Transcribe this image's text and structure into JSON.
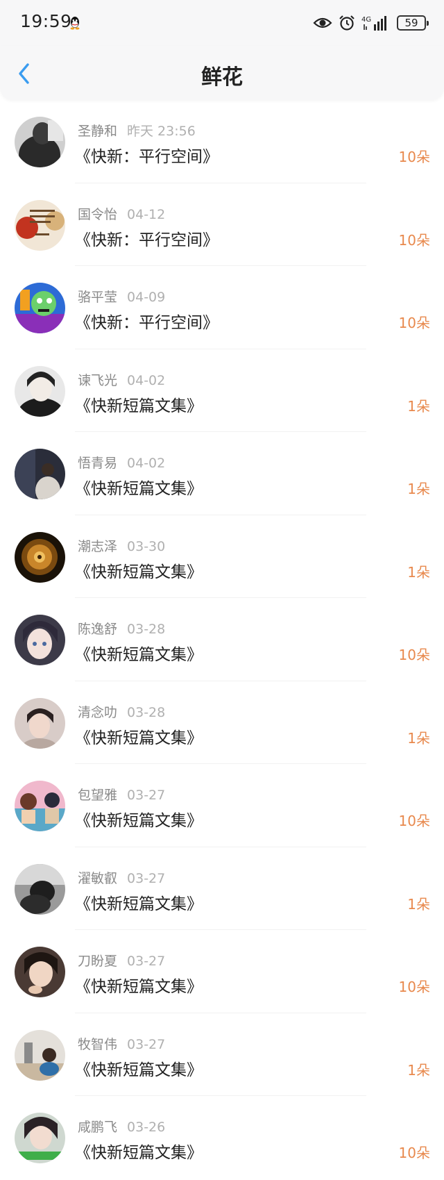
{
  "status_bar": {
    "time": "19:59",
    "battery": "59",
    "network": "4G",
    "icons": [
      "qq-icon",
      "eye-icon",
      "alarm-icon",
      "signal-icon",
      "battery-icon"
    ]
  },
  "header": {
    "title": "鲜花",
    "back_icon": "chevron-left-icon"
  },
  "colors": {
    "accent_blue": "#3a9cf0",
    "flower_orange": "#e8894d",
    "name_gray": "#8a8a8a",
    "date_gray": "#b0b0b0"
  },
  "gifts": [
    {
      "name": "圣静和",
      "date": "昨天 23:56",
      "book": "《快新：平行空间》",
      "flowers": "10朵"
    },
    {
      "name": "国令怡",
      "date": "04-12",
      "book": "《快新：平行空间》",
      "flowers": "10朵"
    },
    {
      "name": "骆平莹",
      "date": "04-09",
      "book": "《快新：平行空间》",
      "flowers": "10朵"
    },
    {
      "name": "谏飞光",
      "date": "04-02",
      "book": "《快新短篇文集》",
      "flowers": "1朵"
    },
    {
      "name": "悟青易",
      "date": "04-02",
      "book": "《快新短篇文集》",
      "flowers": "1朵"
    },
    {
      "name": "潮志泽",
      "date": "03-30",
      "book": "《快新短篇文集》",
      "flowers": "1朵"
    },
    {
      "name": "陈逸舒",
      "date": "03-28",
      "book": "《快新短篇文集》",
      "flowers": "10朵"
    },
    {
      "name": "清念叻",
      "date": "03-28",
      "book": "《快新短篇文集》",
      "flowers": "1朵"
    },
    {
      "name": "包望雅",
      "date": "03-27",
      "book": "《快新短篇文集》",
      "flowers": "10朵"
    },
    {
      "name": "濯敏叡",
      "date": "03-27",
      "book": "《快新短篇文集》",
      "flowers": "1朵"
    },
    {
      "name": "刀盼夏",
      "date": "03-27",
      "book": "《快新短篇文集》",
      "flowers": "10朵"
    },
    {
      "name": "牧智伟",
      "date": "03-27",
      "book": "《快新短篇文集》",
      "flowers": "1朵"
    },
    {
      "name": "咸鹏飞",
      "date": "03-26",
      "book": "《快新短篇文集》",
      "flowers": "10朵"
    }
  ]
}
